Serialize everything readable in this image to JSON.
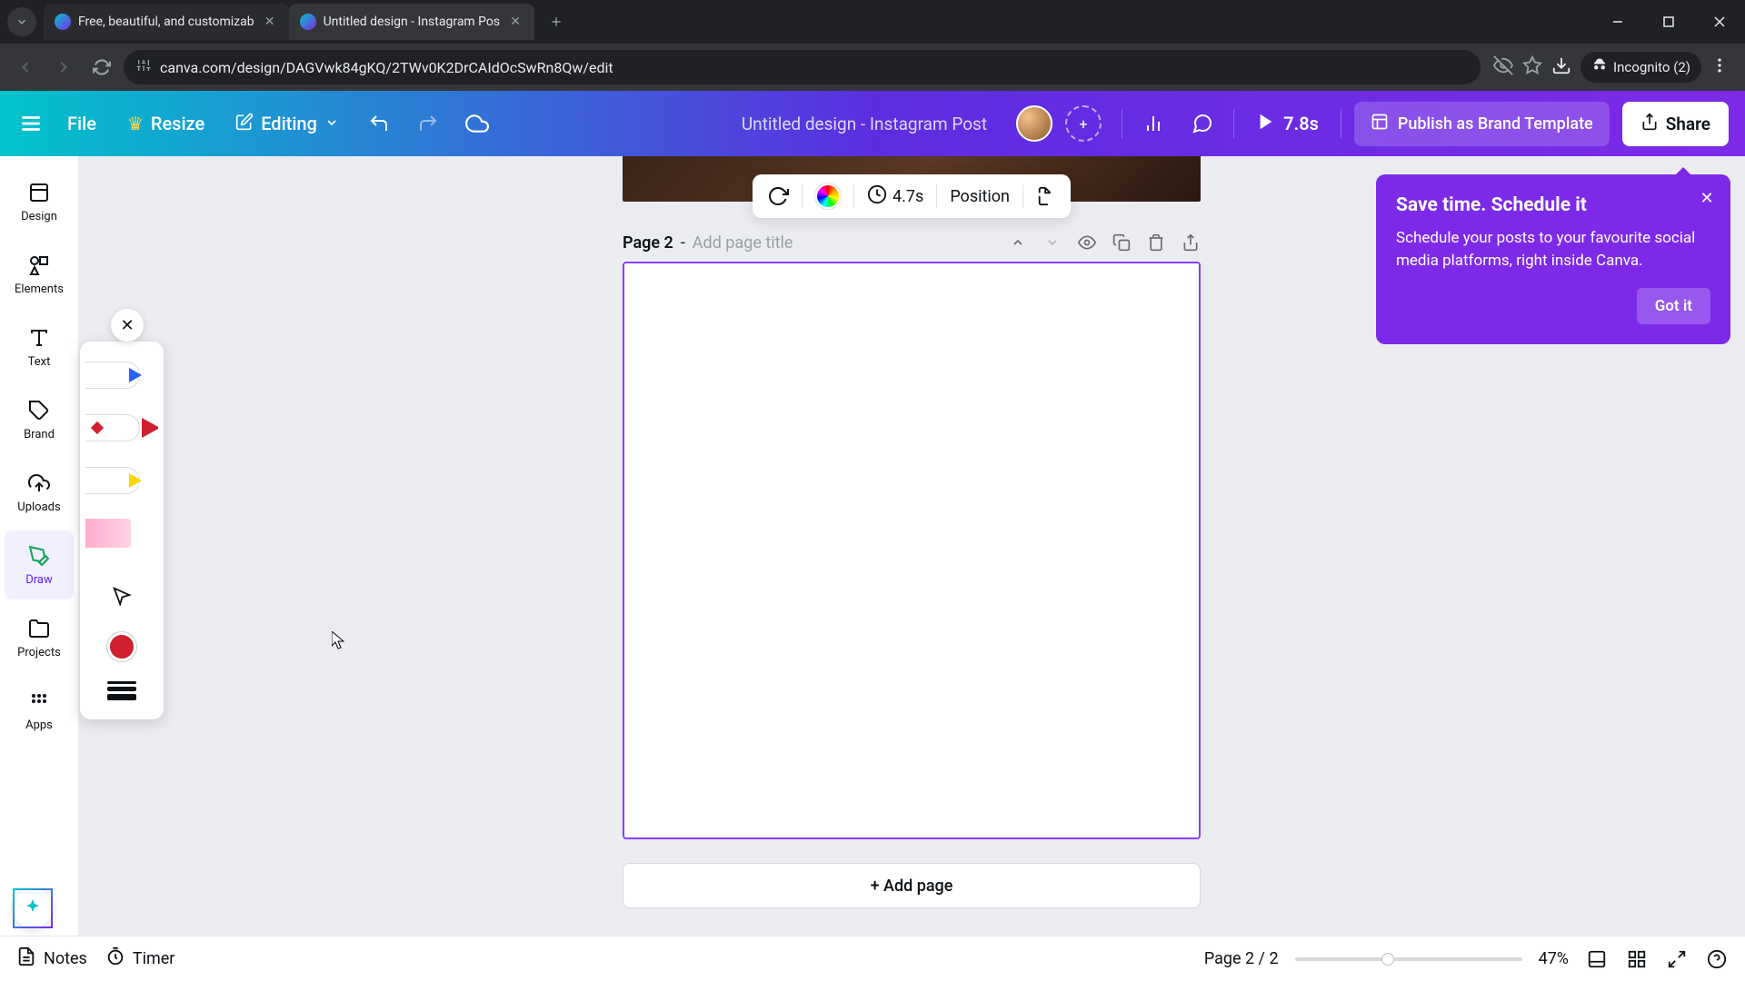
{
  "browser": {
    "tab1_title": "Free, beautiful, and customizab",
    "tab2_title": "Untitled design - Instagram Pos",
    "url": "canva.com/design/DAGVwk84gKQ/2TWv0K2DrCAIdOcSwRn8Qw/edit",
    "incognito": "Incognito (2)"
  },
  "header": {
    "file": "File",
    "resize": "Resize",
    "editing": "Editing",
    "title": "Untitled design - Instagram Post",
    "duration": "7.8s",
    "publish": "Publish as Brand Template",
    "share": "Share"
  },
  "rail": {
    "design": "Design",
    "elements": "Elements",
    "text": "Text",
    "brand": "Brand",
    "uploads": "Uploads",
    "draw": "Draw",
    "projects": "Projects",
    "apps": "Apps"
  },
  "toolbar": {
    "time": "4.7s",
    "position": "Position"
  },
  "page": {
    "label": "Page 2",
    "sep": " - ",
    "placeholder": "Add page title",
    "add": "+ Add page"
  },
  "tooltip": {
    "title": "Save time. Schedule it",
    "body": "Schedule your posts to your favourite social media platforms, right inside Canva.",
    "cta": "Got it"
  },
  "bottom": {
    "notes": "Notes",
    "timer": "Timer",
    "page_indicator": "Page 2 / 2",
    "zoom": "47%"
  }
}
